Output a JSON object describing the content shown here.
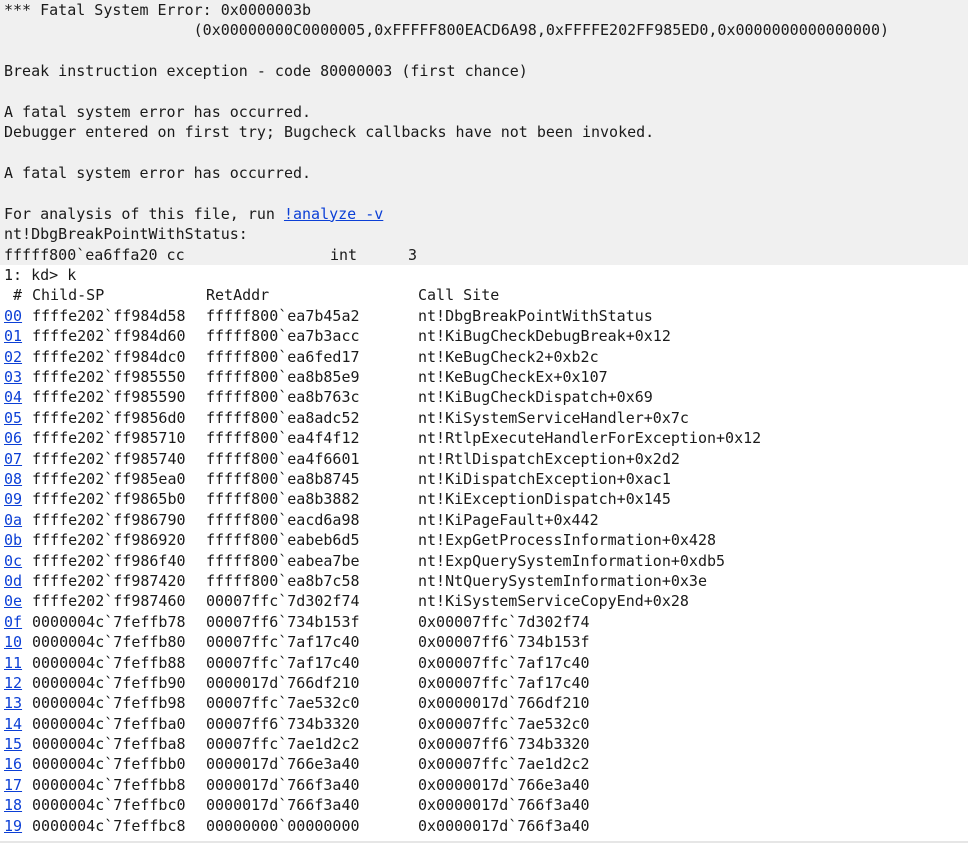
{
  "output": {
    "fatal_title": "*** Fatal System Error: 0x0000003b",
    "fatal_params": "                     (0x00000000C0000005,0xFFFFF800EACD6A98,0xFFFFE202FF985ED0,0x0000000000000000)",
    "break_line": "Break instruction exception - code 80000003 (first chance)",
    "fatal_msg1": "A fatal system error has occurred.",
    "debugger_line": "Debugger entered on first try; Bugcheck callbacks have not been invoked.",
    "fatal_msg2": "A fatal system error has occurred.",
    "analysis_prefix": "For analysis of this file, run ",
    "analysis_link": "!analyze -v",
    "symbol_line": "nt!DbgBreakPointWithStatus:",
    "disasm_addr": "fffff800`ea6ffa20 cc",
    "disasm_op": "int",
    "disasm_arg": "3"
  },
  "prompt": "1: kd> k",
  "stack": {
    "headers": {
      "num": " #",
      "child_sp": "Child-SP",
      "ret_addr": "RetAddr",
      "call_site": "Call Site"
    },
    "frames": [
      {
        "num": "00",
        "child_sp": "ffffe202`ff984d58",
        "ret_addr": "fffff800`ea7b45a2",
        "call_site": "nt!DbgBreakPointWithStatus"
      },
      {
        "num": "01",
        "child_sp": "ffffe202`ff984d60",
        "ret_addr": "fffff800`ea7b3acc",
        "call_site": "nt!KiBugCheckDebugBreak+0x12"
      },
      {
        "num": "02",
        "child_sp": "ffffe202`ff984dc0",
        "ret_addr": "fffff800`ea6fed17",
        "call_site": "nt!KeBugCheck2+0xb2c"
      },
      {
        "num": "03",
        "child_sp": "ffffe202`ff985550",
        "ret_addr": "fffff800`ea8b85e9",
        "call_site": "nt!KeBugCheckEx+0x107"
      },
      {
        "num": "04",
        "child_sp": "ffffe202`ff985590",
        "ret_addr": "fffff800`ea8b763c",
        "call_site": "nt!KiBugCheckDispatch+0x69"
      },
      {
        "num": "05",
        "child_sp": "ffffe202`ff9856d0",
        "ret_addr": "fffff800`ea8adc52",
        "call_site": "nt!KiSystemServiceHandler+0x7c"
      },
      {
        "num": "06",
        "child_sp": "ffffe202`ff985710",
        "ret_addr": "fffff800`ea4f4f12",
        "call_site": "nt!RtlpExecuteHandlerForException+0x12"
      },
      {
        "num": "07",
        "child_sp": "ffffe202`ff985740",
        "ret_addr": "fffff800`ea4f6601",
        "call_site": "nt!RtlDispatchException+0x2d2"
      },
      {
        "num": "08",
        "child_sp": "ffffe202`ff985ea0",
        "ret_addr": "fffff800`ea8b8745",
        "call_site": "nt!KiDispatchException+0xac1"
      },
      {
        "num": "09",
        "child_sp": "ffffe202`ff9865b0",
        "ret_addr": "fffff800`ea8b3882",
        "call_site": "nt!KiExceptionDispatch+0x145"
      },
      {
        "num": "0a",
        "child_sp": "ffffe202`ff986790",
        "ret_addr": "fffff800`eacd6a98",
        "call_site": "nt!KiPageFault+0x442"
      },
      {
        "num": "0b",
        "child_sp": "ffffe202`ff986920",
        "ret_addr": "fffff800`eabeb6d5",
        "call_site": "nt!ExpGetProcessInformation+0x428"
      },
      {
        "num": "0c",
        "child_sp": "ffffe202`ff986f40",
        "ret_addr": "fffff800`eabea7be",
        "call_site": "nt!ExpQuerySystemInformation+0xdb5"
      },
      {
        "num": "0d",
        "child_sp": "ffffe202`ff987420",
        "ret_addr": "fffff800`ea8b7c58",
        "call_site": "nt!NtQuerySystemInformation+0x3e"
      },
      {
        "num": "0e",
        "child_sp": "ffffe202`ff987460",
        "ret_addr": "00007ffc`7d302f74",
        "call_site": "nt!KiSystemServiceCopyEnd+0x28"
      },
      {
        "num": "0f",
        "child_sp": "0000004c`7feffb78",
        "ret_addr": "00007ff6`734b153f",
        "call_site": "0x00007ffc`7d302f74"
      },
      {
        "num": "10",
        "child_sp": "0000004c`7feffb80",
        "ret_addr": "00007ffc`7af17c40",
        "call_site": "0x00007ff6`734b153f"
      },
      {
        "num": "11",
        "child_sp": "0000004c`7feffb88",
        "ret_addr": "00007ffc`7af17c40",
        "call_site": "0x00007ffc`7af17c40"
      },
      {
        "num": "12",
        "child_sp": "0000004c`7feffb90",
        "ret_addr": "0000017d`766df210",
        "call_site": "0x00007ffc`7af17c40"
      },
      {
        "num": "13",
        "child_sp": "0000004c`7feffb98",
        "ret_addr": "00007ffc`7ae532c0",
        "call_site": "0x0000017d`766df210"
      },
      {
        "num": "14",
        "child_sp": "0000004c`7feffba0",
        "ret_addr": "00007ff6`734b3320",
        "call_site": "0x00007ffc`7ae532c0"
      },
      {
        "num": "15",
        "child_sp": "0000004c`7feffba8",
        "ret_addr": "00007ffc`7ae1d2c2",
        "call_site": "0x00007ff6`734b3320"
      },
      {
        "num": "16",
        "child_sp": "0000004c`7feffbb0",
        "ret_addr": "0000017d`766e3a40",
        "call_site": "0x00007ffc`7ae1d2c2"
      },
      {
        "num": "17",
        "child_sp": "0000004c`7feffbb8",
        "ret_addr": "0000017d`766f3a40",
        "call_site": "0x0000017d`766e3a40"
      },
      {
        "num": "18",
        "child_sp": "0000004c`7feffbc0",
        "ret_addr": "0000017d`766f3a40",
        "call_site": "0x0000017d`766f3a40"
      },
      {
        "num": "19",
        "child_sp": "0000004c`7feffbc8",
        "ret_addr": "00000000`00000000",
        "call_site": "0x0000017d`766f3a40"
      }
    ]
  },
  "colors": {
    "output_bg": "#f0f0f0",
    "link": "#0b3fd6",
    "text": "#1a1a1a"
  }
}
